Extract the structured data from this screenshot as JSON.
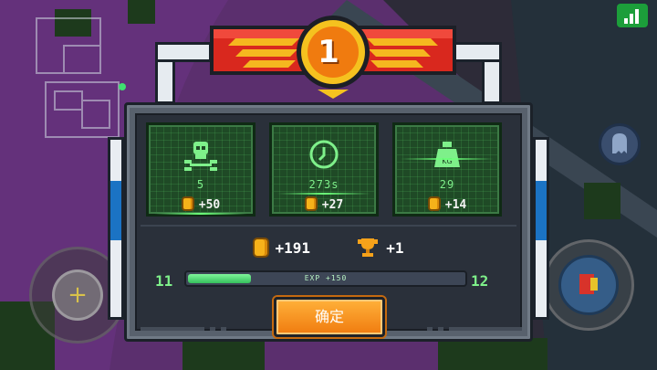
{
  "rank": {
    "number": "1"
  },
  "stats": [
    {
      "id": "kills",
      "icon": "skull-icon",
      "value": "5",
      "reward": "+50"
    },
    {
      "id": "time",
      "icon": "clock-icon",
      "value": "273s",
      "reward": "+27"
    },
    {
      "id": "loot",
      "icon": "weight-icon",
      "value": "29",
      "reward": "+14",
      "icon_text": "KG"
    }
  ],
  "totals": {
    "coins": "+191",
    "trophies": "+1"
  },
  "level": {
    "current": "11",
    "next": "12",
    "exp_text": "EXP +150",
    "exp_progress": 0.23
  },
  "confirm_label": "确定",
  "colors": {
    "panel": "#58616d",
    "stat_bg": "#1f4a26",
    "accent_green": "#7ef08a",
    "button_orange": "#f07b0f",
    "banner_red": "#d9281e",
    "coin_gold": "#f6b21a"
  }
}
